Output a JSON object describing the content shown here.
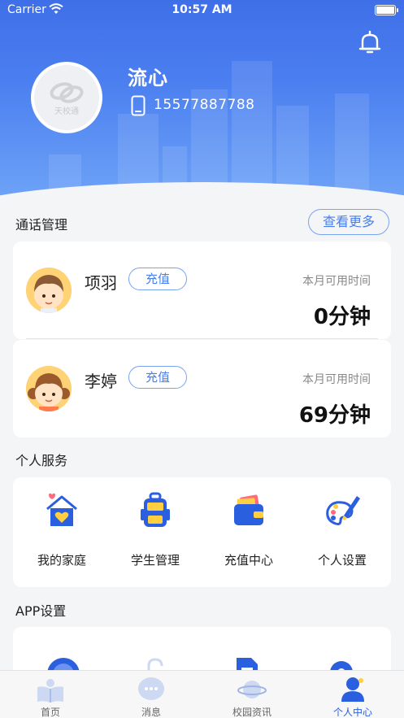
{
  "status_bar": {
    "carrier": "Carrier",
    "time": "10:57 AM"
  },
  "profile": {
    "name": "流心",
    "phone": "15577887788",
    "avatar_logo_text": "天校通"
  },
  "call_management": {
    "title": "通话管理",
    "more_label": "查看更多",
    "contacts": [
      {
        "name": "项羽",
        "recharge_label": "充值",
        "available_label": "本月可用时间",
        "available_value": "0分钟"
      },
      {
        "name": "李婷",
        "recharge_label": "充值",
        "available_label": "本月可用时间",
        "available_value": "69分钟"
      }
    ]
  },
  "personal_services": {
    "title": "个人服务",
    "items": [
      {
        "label": "我的家庭",
        "icon": "house-heart-icon"
      },
      {
        "label": "学生管理",
        "icon": "backpack-icon"
      },
      {
        "label": "充值中心",
        "icon": "wallet-icon"
      },
      {
        "label": "个人设置",
        "icon": "palette-brush-icon"
      }
    ]
  },
  "app_settings": {
    "title": "APP设置"
  },
  "tabbar": {
    "items": [
      {
        "label": "首页",
        "icon": "book-icon"
      },
      {
        "label": "消息",
        "icon": "chat-bubble-icon"
      },
      {
        "label": "校园资讯",
        "icon": "planet-icon"
      },
      {
        "label": "个人中心",
        "icon": "person-icon"
      }
    ],
    "active_index": 3
  },
  "colors": {
    "primary": "#4a7fe8",
    "hero": "#4b7ff0",
    "active_tab": "#2a5fe0"
  }
}
